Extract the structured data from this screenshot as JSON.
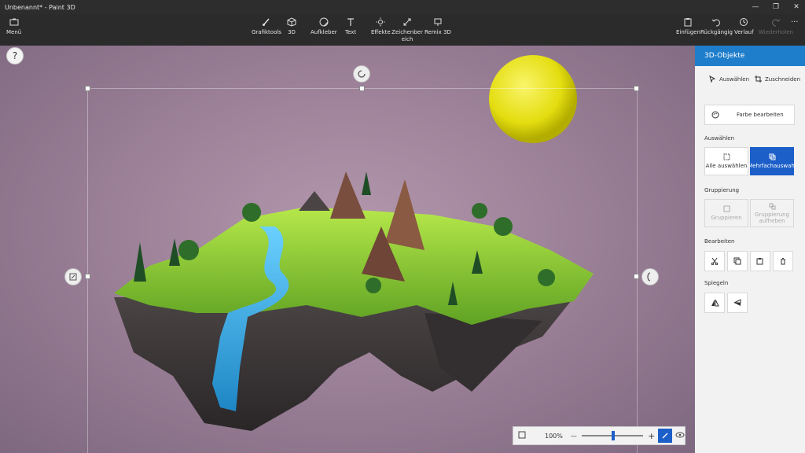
{
  "titlebar": {
    "title": "Unbenannt* - Paint 3D"
  },
  "toolbar": {
    "menu": "Menü",
    "brushes": "Grafiktools",
    "shapes3d": "3D",
    "stickers": "Aufkleber",
    "text": "Text",
    "effects": "Effekte",
    "canvas": "Zeichenber eich",
    "remix": "Remix 3D",
    "paste": "Einfügen",
    "undo": "Rückgängig",
    "history": "Verlauf",
    "redo": "Wiederholen"
  },
  "canvas": {
    "help": "?"
  },
  "zoom": {
    "value": "100%",
    "minus": "—",
    "plus": "+",
    "level": 0.5
  },
  "panel": {
    "title": "3D-Objekte",
    "select": "Auswählen",
    "crop": "Zuschneiden",
    "edit_color": "Farbe bearbeiten",
    "select_section": "Auswählen",
    "select_all": "Alle auswählen",
    "multi_select": "Mehrfachauswahl",
    "group_section": "Gruppierung",
    "group": "Gruppieren",
    "ungroup": "Gruppierung aufheben",
    "edit_section": "Bearbeiten",
    "mirror_section": "Spiegeln"
  },
  "colors": {
    "accent": "#1f7ecb",
    "active": "#1d5fc9",
    "sun": "#e8e21a"
  }
}
